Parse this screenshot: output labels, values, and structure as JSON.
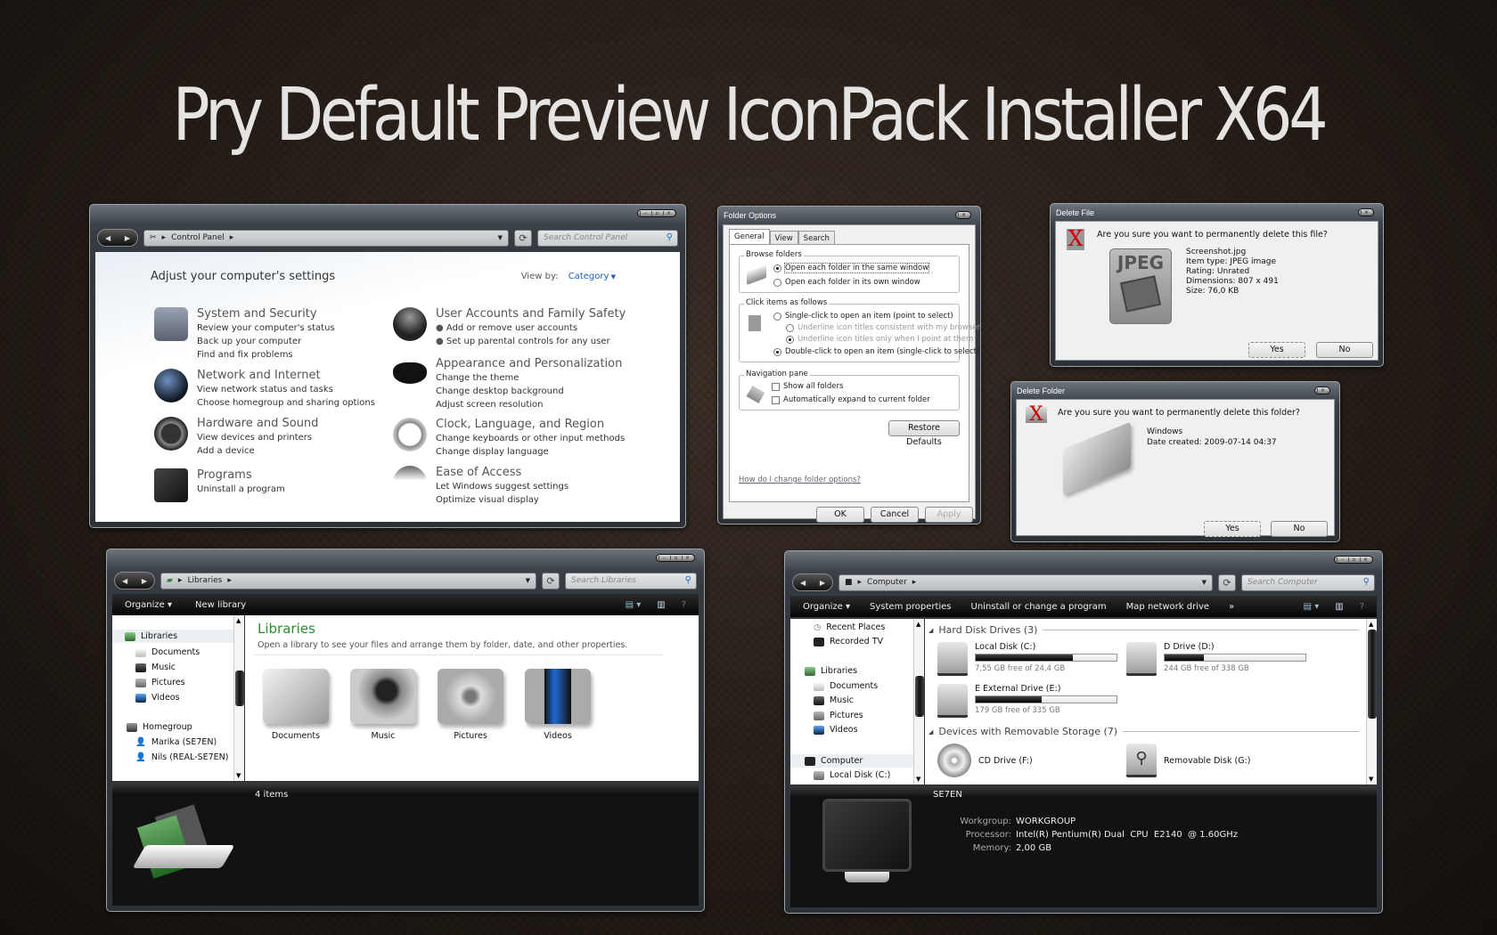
{
  "banner": {
    "title": "Pry Default Preview IconPack Installer X64"
  },
  "control_panel": {
    "address": "Control Panel",
    "search_placeholder": "Search Control Panel",
    "heading": "Adjust your computer's settings",
    "view_by_label": "View by:",
    "view_by_value": "Category",
    "categories": [
      {
        "title": "System and Security",
        "links": [
          "Review your computer's status",
          "Back up your computer",
          "Find and fix problems"
        ],
        "icon": "system-security-icon"
      },
      {
        "title": "Network and Internet",
        "links": [
          "View network status and tasks",
          "Choose homegroup and sharing options"
        ],
        "icon": "network-globe-icon"
      },
      {
        "title": "Hardware and Sound",
        "links": [
          "View devices and printers",
          "Add a device"
        ],
        "icon": "headphones-icon"
      },
      {
        "title": "Programs",
        "links": [
          "Uninstall a program"
        ],
        "icon": "floppy-disks-icon"
      },
      {
        "title": "User Accounts and Family Safety",
        "links": [
          "Add or remove user accounts",
          "Set up parental controls for any user"
        ],
        "icon": "users-icon"
      },
      {
        "title": "Appearance and Personalization",
        "links": [
          "Change the theme",
          "Change desktop background",
          "Adjust screen resolution"
        ],
        "icon": "mask-icon"
      },
      {
        "title": "Clock, Language, and Region",
        "links": [
          "Change keyboards or other input methods",
          "Change display language"
        ],
        "icon": "alarm-clock-icon"
      },
      {
        "title": "Ease of Access",
        "links": [
          "Let Windows suggest settings",
          "Optimize visual display"
        ],
        "icon": "umbrella-icon"
      }
    ]
  },
  "folder_options": {
    "title": "Folder Options",
    "tabs": [
      "General",
      "View",
      "Search"
    ],
    "browse": {
      "label": "Browse folders",
      "options": [
        "Open each folder in the same window",
        "Open each folder in its own window"
      ],
      "selected": 0
    },
    "click": {
      "label": "Click items as follows",
      "single": "Single-click to open an item (point to select)",
      "sub1": "Underline icon titles consistent with my browser",
      "sub2": "Underline icon titles only when I point at them",
      "double": "Double-click to open an item (single-click to select)"
    },
    "nav": {
      "label": "Navigation pane",
      "show_all": "Show all folders",
      "auto_expand": "Automatically expand to current folder"
    },
    "restore": "Restore Defaults",
    "help_link": "How do I change folder options?",
    "ok": "OK",
    "cancel": "Cancel",
    "apply": "Apply"
  },
  "delete_file": {
    "title": "Delete File",
    "question": "Are you sure you want to permanently delete this file?",
    "icon_label": "JPEG",
    "details": [
      "Screenshot.jpg",
      "Item type: JPEG image",
      "Rating: Unrated",
      "Dimensions: 807 x 491",
      "Size: 76,0 KB"
    ],
    "yes": "Yes",
    "no": "No"
  },
  "delete_folder": {
    "title": "Delete Folder",
    "question": "Are you sure you want to permanently delete this folder?",
    "details": [
      "Windows",
      "Date created: 2009-07-14 04:37"
    ],
    "yes": "Yes",
    "no": "No"
  },
  "libraries": {
    "address": "Libraries",
    "search_placeholder": "Search Libraries",
    "toolbar": {
      "organize": "Organize",
      "new_library": "New library"
    },
    "sidebar": {
      "libraries": "Libraries",
      "lib_items": [
        "Documents",
        "Music",
        "Pictures",
        "Videos"
      ],
      "homegroup": "Homegroup",
      "users": [
        "Marika (SE7EN)",
        "Nils (REAL-SE7EN)"
      ]
    },
    "heading": "Libraries",
    "subtitle": "Open a library to see your files and arrange them by folder, date, and other properties.",
    "items": [
      "Documents",
      "Music",
      "Pictures",
      "Videos"
    ],
    "status": "4 items",
    "accent": "#2e8b2e"
  },
  "computer": {
    "address": "Computer",
    "search_placeholder": "Search Computer",
    "toolbar": {
      "organize": "Organize",
      "system_properties": "System properties",
      "uninstall": "Uninstall or change a program",
      "map_drive": "Map network drive",
      "more": "»"
    },
    "sidebar": {
      "recent": "Recent Places",
      "recorded_tv": "Recorded TV",
      "libraries": "Libraries",
      "lib_items": [
        "Documents",
        "Music",
        "Pictures",
        "Videos"
      ],
      "computer": "Computer",
      "local_disk": "Local Disk (C:)"
    },
    "hdd_section": "Hard Disk Drives (3)",
    "drives": [
      {
        "name": "Local Disk (C:)",
        "free": "7,55 GB free of 24,4 GB",
        "used_fraction": 0.69
      },
      {
        "name": "D Drive (D:)",
        "free": "244 GB free of 338 GB",
        "used_fraction": 0.28
      },
      {
        "name": "E External Drive (E:)",
        "free": "179 GB free of 335 GB",
        "used_fraction": 0.47
      }
    ],
    "removable_section": "Devices with Removable Storage (7)",
    "removable": [
      "CD Drive (F:)",
      "Removable Disk (G:)"
    ],
    "details": {
      "name": "SE7EN",
      "workgroup_label": "Workgroup:",
      "workgroup": "WORKGROUP",
      "processor_label": "Processor:",
      "processor": "Intel(R) Pentium(R) Dual  CPU  E2140  @ 1.60GHz",
      "memory_label": "Memory:",
      "memory": "2,00 GB"
    }
  }
}
